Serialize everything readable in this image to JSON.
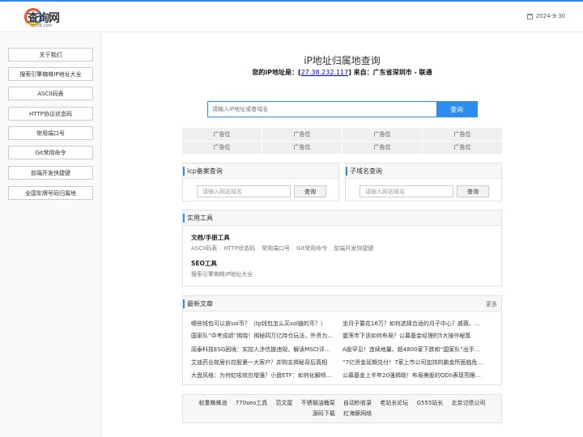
{
  "header": {
    "logo_text": "查询网",
    "logo_sub": "ip138.com",
    "date": "2024-9-30"
  },
  "sidebar": {
    "items": [
      {
        "label": "关于我们"
      },
      {
        "label": "搜索引擎蜘蛛IP地址大全"
      },
      {
        "label": "ASCII码表"
      },
      {
        "label": "HTTP协议状态码"
      },
      {
        "label": "常用端口号"
      },
      {
        "label": "Git常用命令"
      },
      {
        "label": "前端开发快捷键"
      },
      {
        "label": "全国车牌号码归属地"
      }
    ]
  },
  "main": {
    "title": "iP地址归属地查询",
    "ip_prefix": "您的iP地址是：[",
    "ip": "27.38.232.117",
    "ip_suffix": "] 来自：广东省深圳市 - 联通",
    "search_placeholder": "请输入iP地址或者域名",
    "search_button": "查询"
  },
  "ads": [
    "广告位",
    "广告位",
    "广告位",
    "广告位",
    "广告位",
    "广告位",
    "广告位",
    "广告位"
  ],
  "icp": {
    "title": "icp备案查询",
    "placeholder": "请输入网站域名",
    "button": "查询"
  },
  "subdomain": {
    "title": "子域名查询",
    "placeholder": "请输入网站域名",
    "button": "查询"
  },
  "tools": {
    "title": "实用工具",
    "group1_title": "文档/手册工具",
    "group1_links": [
      "ASCII码表",
      "HTTP状态码",
      "常用端口号",
      "Git常用命令",
      "前端开发快捷键"
    ],
    "group2_title": "SEO工具",
    "group2_links": [
      "搜索引擎蜘蛛IP地址大全"
    ]
  },
  "news": {
    "title": "最新文章",
    "more": "更多",
    "items": [
      "哪些钱包可以放sol币？（tp钱包怎么买sol链的币？）",
      "坐月子要花16万？如何选择合适的月子中心？戚薇、古...",
      "国家队“中考成绩”揭晓！揭秘四万亿持仓玩法，外资为...",
      "震荡市下该如何布局？公募基金经理的5大操作秘笈",
      "阅泰科技ESG困境：实控人涉信披违规，解读MSCI评分...",
      "A股罕见！连续地量、超4800家下跌和“国家队”出手，竟...",
      "艾迪药业故居价控股第一大客户？并购志揭秘背后真相",
      "“7亿资金延期兑付！7家上市公司加持的鹏金所面临危机...",
      "大盘风格：为何虹吸效应增强？小盘ETF：如何化解喷...",
      "公募基金上半年20强揭晓！布局美股的QDII表现亮眼！..."
    ]
  },
  "friends": {
    "links": [
      "权重蜘蛛池",
      "770seo工具",
      "范文屋",
      "不锈钢油桶泵",
      "自动秒收录",
      "老站长论坛",
      "G555站长",
      "北京讨债公司",
      "源码下载",
      "红海豚网络"
    ]
  }
}
